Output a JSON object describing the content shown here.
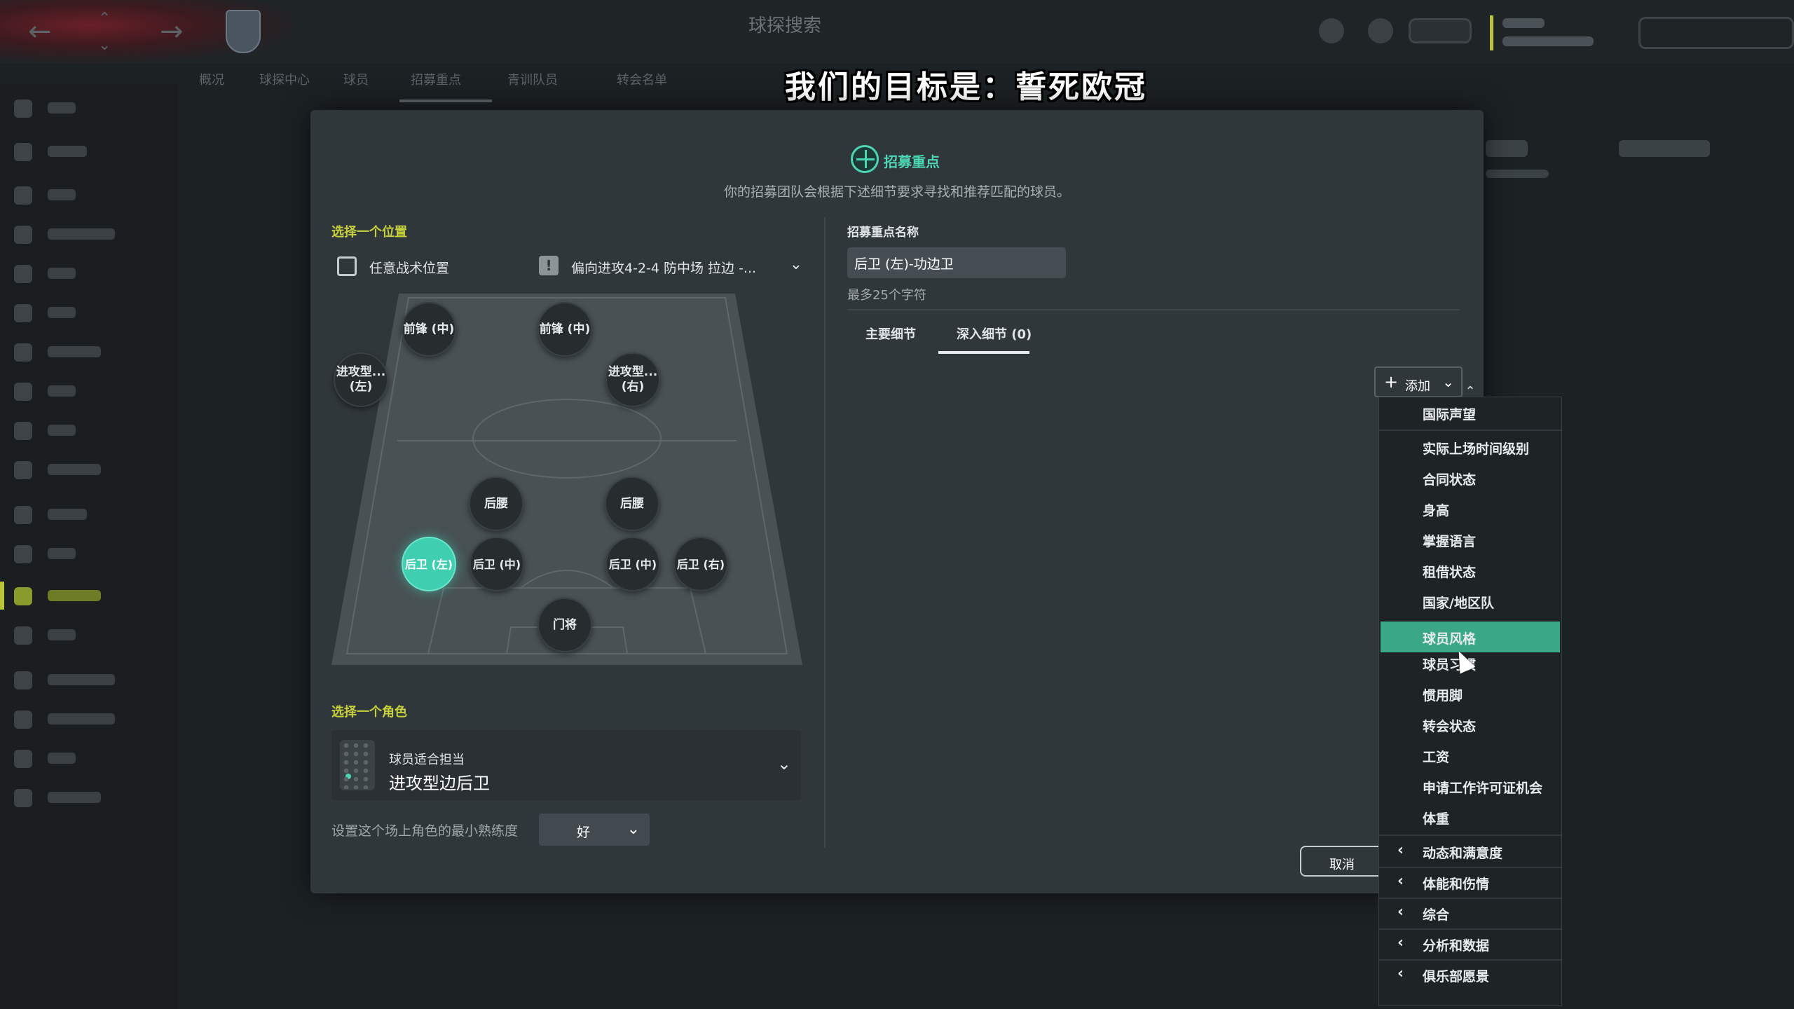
{
  "subtitle": "我们的目标是：誓死欧冠",
  "background": {
    "screen_title": "球探搜索",
    "subnav": [
      "概况",
      "球探中心",
      "球员",
      "招募重点",
      "青训队员",
      "转会名单"
    ]
  },
  "modal": {
    "title": "招募重点",
    "description": "你的招募团队会根据下述细节要求寻找和推荐匹配的球员。",
    "left": {
      "position_section_label": "选择一个位置",
      "any_position_label": "任意战术位置",
      "formation": "偏向进攻4-2-4 防中场 拉边 -...",
      "positions": [
        {
          "id": "st-l",
          "label": "前锋 (中)"
        },
        {
          "id": "st-r",
          "label": "前锋 (中)"
        },
        {
          "id": "am-l",
          "label": "进攻型...\n(左)"
        },
        {
          "id": "am-r",
          "label": "进攻型...\n(右)"
        },
        {
          "id": "dm-l",
          "label": "后腰"
        },
        {
          "id": "dm-r",
          "label": "后腰"
        },
        {
          "id": "dl",
          "label": "后卫 (左)",
          "selected": true
        },
        {
          "id": "dc-l",
          "label": "后卫 (中)"
        },
        {
          "id": "dc-r",
          "label": "后卫 (中)"
        },
        {
          "id": "dr",
          "label": "后卫 (右)"
        },
        {
          "id": "gk",
          "label": "门将"
        }
      ],
      "role_section_label": "选择一个角色",
      "role_subtitle": "球员适合担当",
      "role_value": "进攻型边后卫",
      "proficiency_label": "设置这个场上角色的最小熟练度",
      "proficiency_value": "好"
    },
    "right": {
      "name_label": "招募重点名称",
      "name_value": "后卫 (左)-功边卫",
      "name_hint": "最多25个字符",
      "tabs": [
        "主要细节",
        "深入细节 (0)"
      ],
      "active_tab": 1,
      "add_button_label": "添加",
      "cancel_button_label": "取消"
    }
  },
  "dropdown": {
    "items": [
      {
        "label": "国际声望"
      },
      {
        "label": "实际上场时间级别"
      },
      {
        "label": "合同状态"
      },
      {
        "label": "身高"
      },
      {
        "label": "掌握语言"
      },
      {
        "label": "租借状态"
      },
      {
        "label": "国家/地区队"
      },
      {
        "label": "球员风格",
        "highlighted": true
      },
      {
        "label": "球员习惯"
      },
      {
        "label": "惯用脚"
      },
      {
        "label": "转会状态"
      },
      {
        "label": "工资"
      },
      {
        "label": "申请工作许可证机会"
      },
      {
        "label": "体重"
      }
    ],
    "submenus": [
      "动态和满意度",
      "体能和伤情",
      "综合",
      "分析和数据",
      "俱乐部愿景"
    ]
  },
  "colors": {
    "accent_teal": "#4dd6b4",
    "section_yellow": "#c7d13d",
    "highlight": "#3aa886",
    "modal_bg": "#30373b"
  }
}
